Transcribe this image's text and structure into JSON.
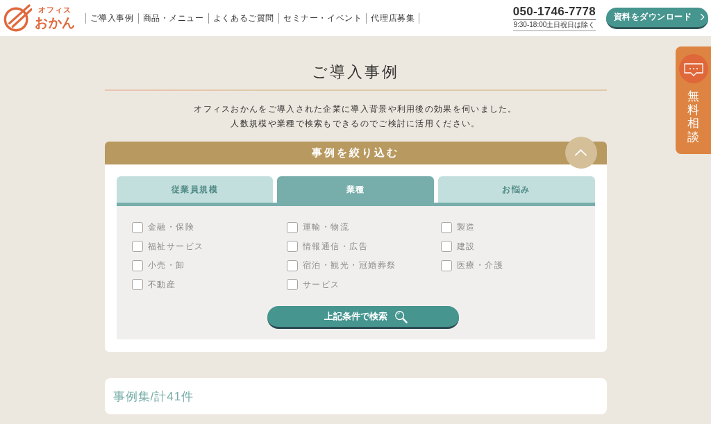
{
  "header": {
    "logo": {
      "subtitle": "オフィス",
      "name": "おかん"
    },
    "nav": [
      "ご導入事例",
      "商品・メニュー",
      "よくあるご質問",
      "セミナー・イベント",
      "代理店募集"
    ],
    "phone": {
      "number": "050-1746-7778",
      "hours": "9:30-18:00土日祝日は除く"
    },
    "download_button": "資料をダウンロード"
  },
  "intro": {
    "title": "ご導入事例",
    "description": [
      "オフィスおかんをご導入された企業に導入背景や利用後の効果を伺いました。",
      "人数規模や業種で検索もできるのでご検討に活用ください。"
    ]
  },
  "filter": {
    "title": "事例を絞り込む",
    "expanded": true,
    "tabs": [
      {
        "label": "従業員規模",
        "selected": false
      },
      {
        "label": "業種",
        "selected": true
      },
      {
        "label": "お悩み",
        "selected": false
      }
    ],
    "option_columns": [
      [
        {
          "label": "金融・保険",
          "checked": false
        },
        {
          "label": "福祉サービス",
          "checked": false
        },
        {
          "label": "小売・卸",
          "checked": false
        },
        {
          "label": "不動産",
          "checked": false
        }
      ],
      [
        {
          "label": "運輸・物流",
          "checked": false
        },
        {
          "label": "情報通信・広告",
          "checked": false
        },
        {
          "label": "宿泊・観光・冠婚葬祭",
          "checked": false
        },
        {
          "label": "サービス",
          "checked": false
        }
      ],
      [
        {
          "label": "製造",
          "checked": false
        },
        {
          "label": "建設",
          "checked": false
        },
        {
          "label": "医療・介護",
          "checked": false
        }
      ]
    ],
    "search_button": "上記条件で検索"
  },
  "results": {
    "heading": "事例集/計41件"
  },
  "side_tab": {
    "label": "無料相談"
  }
}
